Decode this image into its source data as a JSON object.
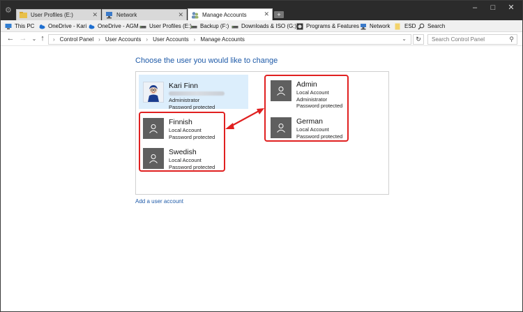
{
  "tabs": [
    {
      "label": "User Profiles (E:)",
      "active": false
    },
    {
      "label": "Network",
      "active": false
    },
    {
      "label": "Manage Accounts",
      "active": true
    }
  ],
  "favorites": [
    {
      "label": "This PC",
      "icon": "computer-icon"
    },
    {
      "label": "OneDrive - Kari",
      "icon": "cloud-icon"
    },
    {
      "label": "OneDrive - AGM",
      "icon": "cloud-icon"
    },
    {
      "label": "User Profiles (E:)",
      "icon": "drive-icon"
    },
    {
      "label": "Backup (F:)",
      "icon": "drive-icon"
    },
    {
      "label": "Downloads & ISO (G:)",
      "icon": "drive-icon"
    },
    {
      "label": "Programs & Features",
      "icon": "programs-icon"
    },
    {
      "label": "Network",
      "icon": "network-icon"
    },
    {
      "label": "ESD",
      "icon": "folder-icon"
    },
    {
      "label": "Search",
      "icon": "search-icon"
    }
  ],
  "breadcrumbs": [
    "Control Panel",
    "User Accounts",
    "User Accounts",
    "Manage Accounts"
  ],
  "search": {
    "placeholder": "Search Control Panel"
  },
  "page": {
    "heading": "Choose the user you would like to change",
    "add_user_link": "Add a user account"
  },
  "accounts": [
    {
      "name": "Kari Finn",
      "lines": [
        "Administrator",
        "Password protected"
      ],
      "selected": true
    },
    {
      "name": "Finnish",
      "lines": [
        "Local Account",
        "Password protected"
      ]
    },
    {
      "name": "Swedish",
      "lines": [
        "Local Account",
        "Password protected"
      ]
    },
    {
      "name": "Admin",
      "lines": [
        "Local Account",
        "Administrator",
        "Password protected"
      ]
    },
    {
      "name": "German",
      "lines": [
        "Local Account",
        "Password protected"
      ]
    }
  ],
  "colors": {
    "accent": "#1e5aa8",
    "highlight": "#e02020",
    "selected_bg": "#dceefc"
  }
}
